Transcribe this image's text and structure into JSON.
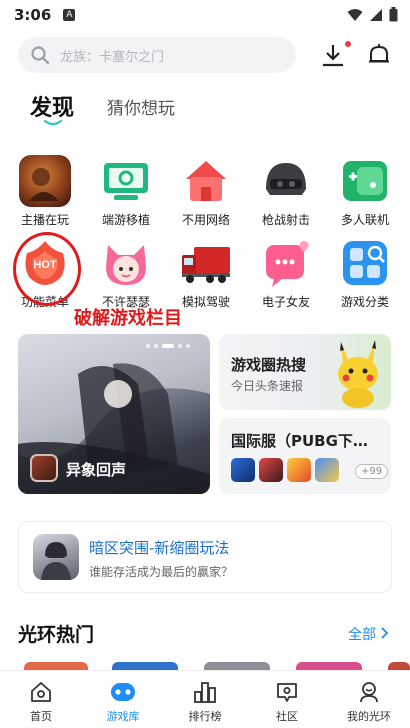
{
  "status_bar": {
    "time": "3:06",
    "app_letter": "A"
  },
  "search": {
    "placeholder": "龙族：卡塞尔之门"
  },
  "tabs": [
    {
      "label": "发现",
      "active": true
    },
    {
      "label": "猜你想玩",
      "active": false
    }
  ],
  "categories": [
    {
      "label": "主播在玩",
      "icon": "streamer-game-icon"
    },
    {
      "label": "端游移植",
      "icon": "pc-port-icon"
    },
    {
      "label": "不用网络",
      "icon": "offline-icon"
    },
    {
      "label": "枪战射击",
      "icon": "shooter-helmet-icon"
    },
    {
      "label": "多人联机",
      "icon": "multiplayer-icon"
    },
    {
      "label": "功能菜单",
      "icon": "hot-menu-icon"
    },
    {
      "label": "不许瑟瑟",
      "icon": "anime-girl-icon"
    },
    {
      "label": "模拟驾驶",
      "icon": "truck-icon"
    },
    {
      "label": "电子女友",
      "icon": "chat-heart-icon"
    },
    {
      "label": "游戏分类",
      "icon": "category-grid-icon"
    }
  ],
  "hot_badge": "HOT",
  "annotation": "破解游戏栏目",
  "banners": {
    "main": {
      "title": "异象回声"
    },
    "hot_search": {
      "title": "游戏圈热搜",
      "subtitle": "今日头条速报"
    },
    "international": {
      "title": "国际服（PUBG下载…",
      "more_badge": "+99"
    }
  },
  "feature_card": {
    "title": "暗区突围-新缩圈玩法",
    "subtitle": "谁能存活成为最后的赢家？"
  },
  "section": {
    "title": "光环热门",
    "more": "全部"
  },
  "bottom_nav": [
    {
      "label": "首页",
      "icon": "home-icon",
      "active": false
    },
    {
      "label": "游戏库",
      "icon": "gamepad-icon",
      "active": true
    },
    {
      "label": "排行榜",
      "icon": "ranking-icon",
      "active": false
    },
    {
      "label": "社区",
      "icon": "community-icon",
      "active": false
    },
    {
      "label": "我的光环",
      "icon": "profile-icon",
      "active": false
    }
  ],
  "colors": {
    "accent": "#1e8ef5",
    "annotation": "#e0191c",
    "link": "#1b6fd1"
  }
}
